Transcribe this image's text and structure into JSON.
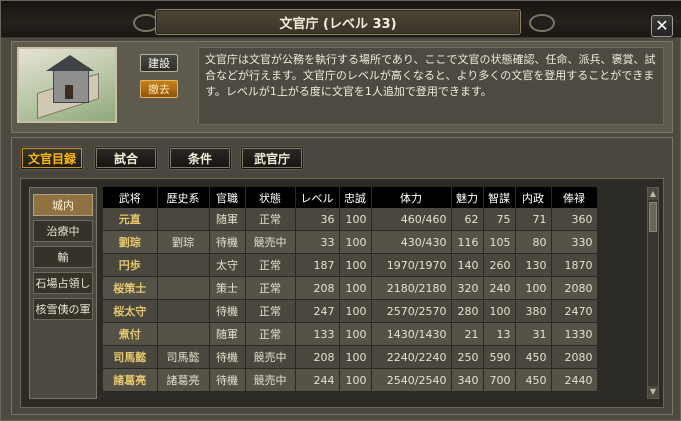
{
  "window": {
    "title": "文官庁 (レベル 33)",
    "close_label": "✕"
  },
  "building": {
    "build_label": "建設",
    "demolish_label": "撤去",
    "description": "文官庁は文官が公務を執行する場所であり、ここで文官の状態確認、任命、派兵、褒賞、試合などが行えます。文官庁のレベルが高くなると、より多くの文官を登用することができます。レベルが1上がる度に文官を1人追加で登用できます。"
  },
  "tabs": [
    {
      "label": "文官目録",
      "active": true
    },
    {
      "label": "試合",
      "active": false
    },
    {
      "label": "条件",
      "active": false
    },
    {
      "label": "武官庁",
      "active": false
    }
  ],
  "sidebar": {
    "items": [
      {
        "label": "城内",
        "active": true
      },
      {
        "label": "治療中",
        "active": false
      },
      {
        "label": "輸",
        "active": false
      },
      {
        "label": "石場占領し",
        "active": false
      },
      {
        "label": "核雪侇の軍",
        "active": false
      }
    ]
  },
  "table": {
    "headers": [
      "武将",
      "歴史系",
      "官職",
      "状態",
      "レベル",
      "忠誠",
      "体力",
      "魅力",
      "智謀",
      "内政",
      "俸禄"
    ],
    "rows": [
      [
        "元直",
        "",
        "随軍",
        "正常",
        "36",
        "100",
        "460/460",
        "62",
        "75",
        "71",
        "360"
      ],
      [
        "劉琮",
        "劉琮",
        "待機",
        "競売中",
        "33",
        "100",
        "430/430",
        "116",
        "105",
        "80",
        "330"
      ],
      [
        "円歩",
        "",
        "太守",
        "正常",
        "187",
        "100",
        "1970/1970",
        "140",
        "260",
        "130",
        "1870"
      ],
      [
        "桜策士",
        "",
        "策士",
        "正常",
        "208",
        "100",
        "2180/2180",
        "320",
        "240",
        "100",
        "2080"
      ],
      [
        "桜太守",
        "",
        "待機",
        "正常",
        "247",
        "100",
        "2570/2570",
        "280",
        "100",
        "380",
        "2470"
      ],
      [
        "煮付",
        "",
        "随軍",
        "正常",
        "133",
        "100",
        "1430/1430",
        "21",
        "13",
        "31",
        "1330"
      ],
      [
        "司馬懿",
        "司馬懿",
        "待機",
        "競売中",
        "208",
        "100",
        "2240/2240",
        "250",
        "590",
        "450",
        "2080"
      ],
      [
        "諸葛亮",
        "諸葛亮",
        "待機",
        "競売中",
        "244",
        "100",
        "2540/2540",
        "340",
        "700",
        "450",
        "2440"
      ]
    ]
  },
  "colors": {
    "accent": "#ffb600",
    "name_text": "#e5c76e",
    "active_side": "#8f7241",
    "demolish": "#c9801c"
  }
}
